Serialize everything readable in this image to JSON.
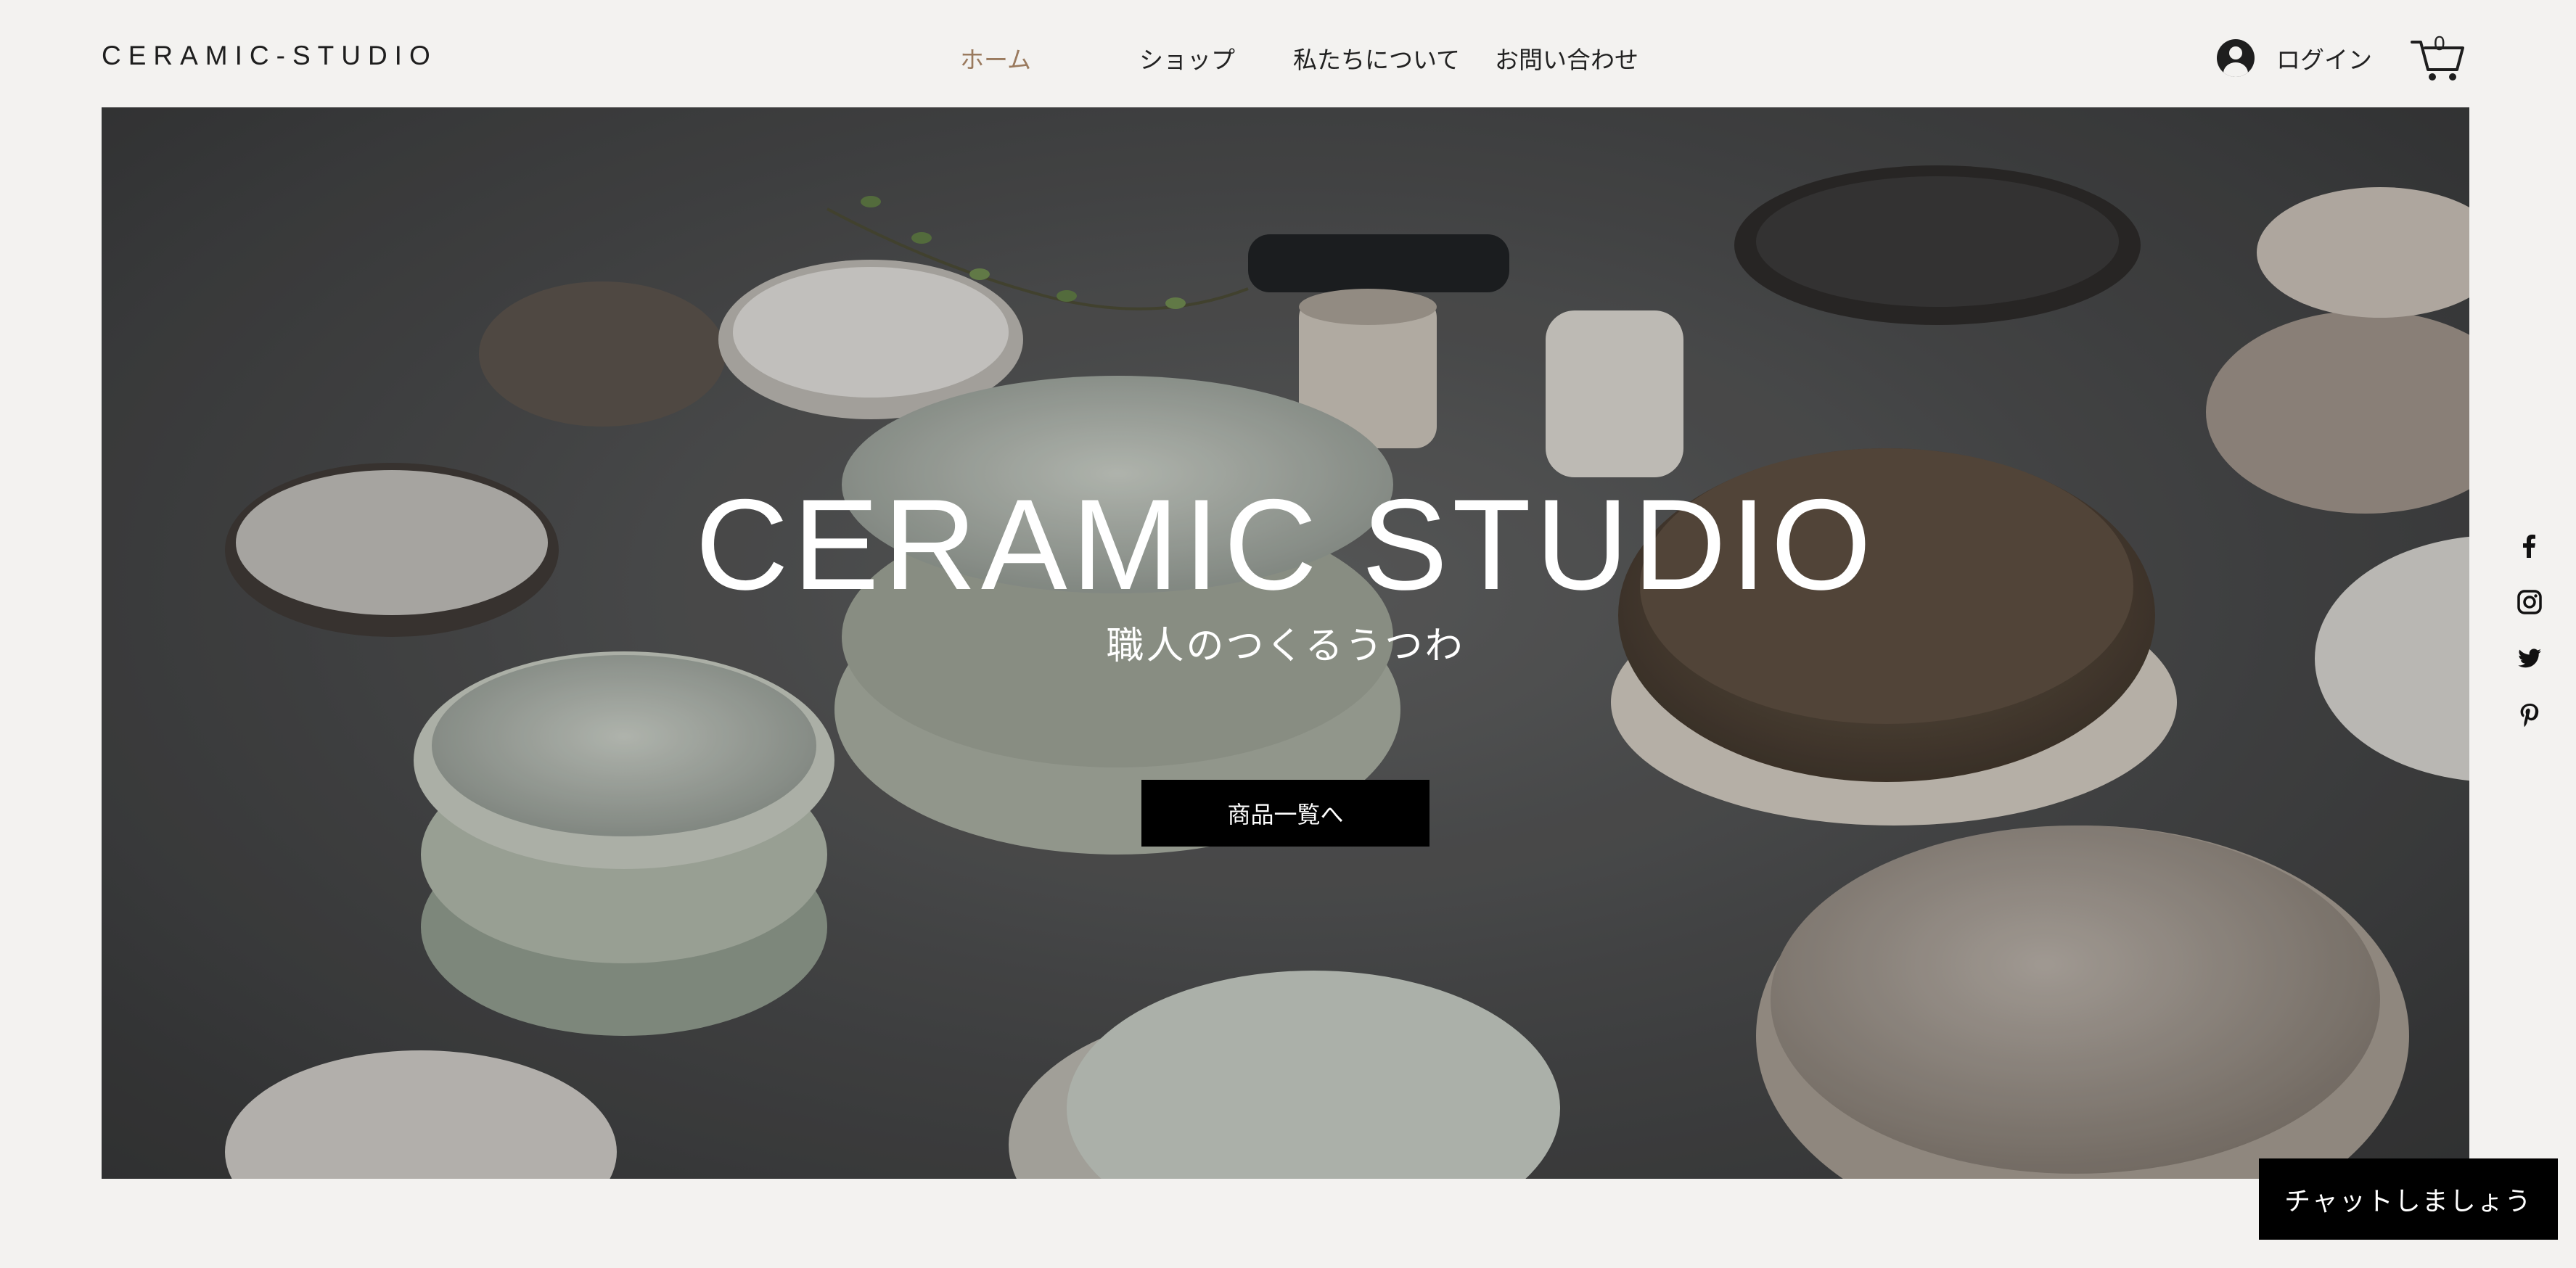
{
  "site": {
    "logo": "CERAMIC-STUDIO"
  },
  "nav": {
    "items": [
      {
        "label": "ホーム",
        "active": true
      },
      {
        "label": "ショップ",
        "active": false
      },
      {
        "label": "私たちについて",
        "active": false
      },
      {
        "label": "お問い合わせ",
        "active": false
      }
    ]
  },
  "account": {
    "login_label": "ログイン",
    "cart_count": "0"
  },
  "hero": {
    "title": "CERAMIC STUDIO",
    "subtitle": "職人のつくるうつわ",
    "cta_label": "商品一覧へ",
    "image": "ceramic-bowls-on-stone-table"
  },
  "social": {
    "icons": [
      "facebook-icon",
      "instagram-icon",
      "twitter-icon",
      "pinterest-icon"
    ]
  },
  "chat": {
    "label": "チャットしましょう"
  },
  "colors": {
    "background": "#f3f2f0",
    "nav_active": "#9a7a5e",
    "button_bg": "#000000",
    "button_text": "#ffffff"
  }
}
